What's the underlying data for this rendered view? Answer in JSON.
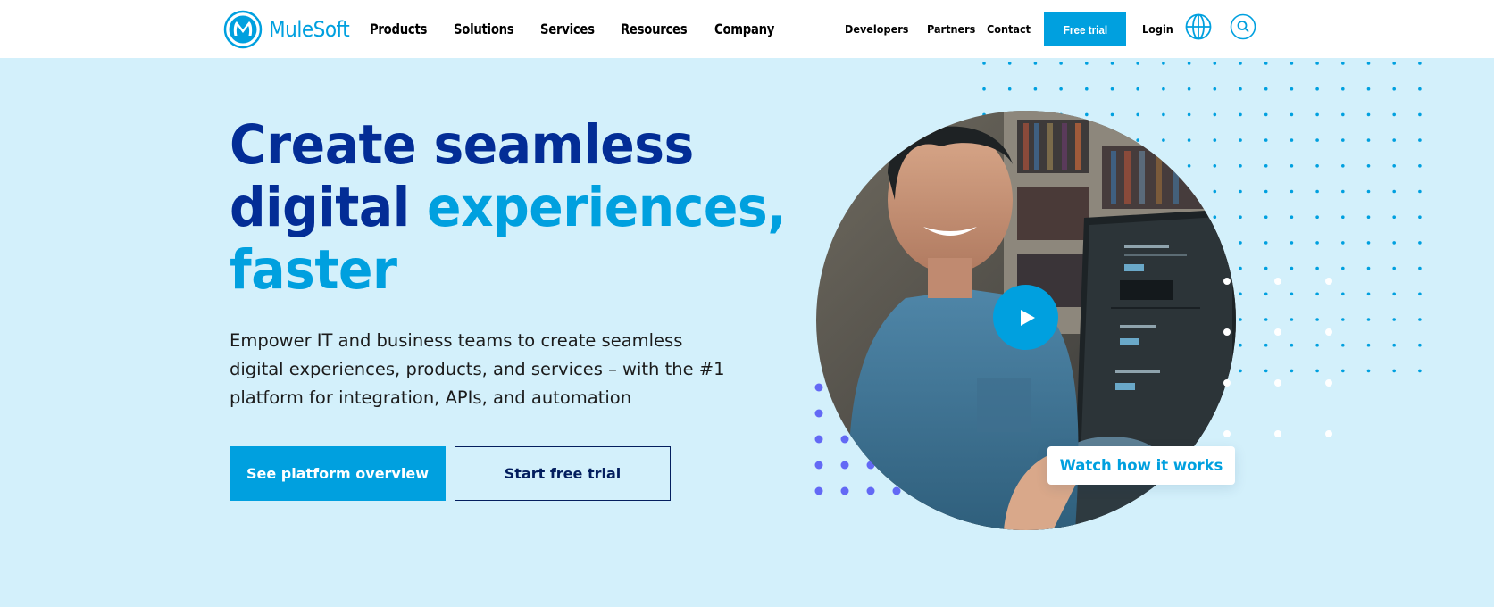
{
  "header": {
    "brand": "MuleSoft",
    "nav_main": [
      "Products",
      "Solutions",
      "Services",
      "Resources",
      "Company"
    ],
    "nav_util": {
      "developers": "Developers",
      "partners": "Partners",
      "contact": "Contact",
      "free_trial": "Free trial",
      "login": "Login"
    },
    "icons": {
      "language": "globe-icon",
      "search": "search-icon"
    }
  },
  "hero": {
    "title_line1": "Create seamless",
    "title_line2_dark": "digital",
    "title_line2_accent": "experiences,",
    "title_line3_accent": "faster",
    "subtitle": "Empower IT and business teams to create seamless digital experiences, products, and services – with the #1 platform for integration, APIs, and automation",
    "primary_button": "See platform overview",
    "secondary_button": "Start free trial",
    "video": {
      "play_icon": "play-icon",
      "watch_label": "Watch how it works"
    }
  },
  "colors": {
    "brand_blue": "#00a0df",
    "navy": "#032d96",
    "hero_bg": "#d3f0fb",
    "purple_dots": "#6369f5"
  }
}
